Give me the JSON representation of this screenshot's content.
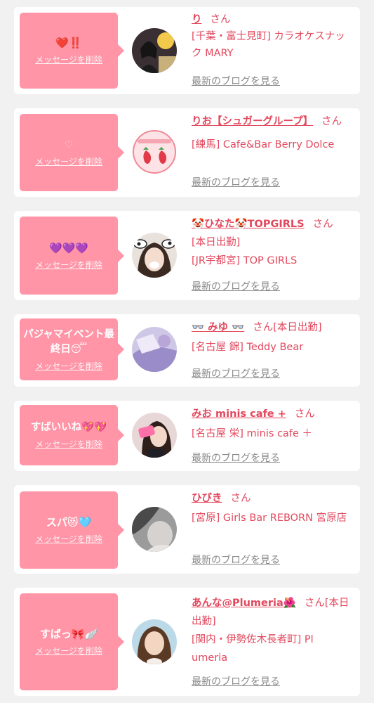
{
  "colors": {
    "background": "#f1f1f1",
    "card": "#ffffff",
    "bubble": "#ff95a7",
    "accent_text": "#e2485d",
    "muted_link": "#8a8a8a"
  },
  "delete_label": "メッセージを削除",
  "blog_label": "最新のブログを見る",
  "entries": [
    {
      "message": "❤️‼️",
      "name": "り",
      "suffix": "さん",
      "shop_lines": [
        "[千葉・富士見町] カラオケスナック MARY"
      ],
      "avatar_icon": "girl-photo-avatar"
    },
    {
      "message": "♡",
      "name": "りお【シュガーグループ】",
      "suffix": "さん",
      "shop_lines": [
        "[練馬] Cafe&Bar Berry Dolce"
      ],
      "avatar_icon": "strawberry-avatar"
    },
    {
      "message": "💜💜💜",
      "name": "🤡ひなた🤡TOPGIRLS",
      "suffix": "さん",
      "shop_lines": [
        "[本日出勤]",
        "[JR宇都宮] TOP GIRLS"
      ],
      "avatar_icon": "girl-cow-ears-avatar"
    },
    {
      "message": "パジャマイベント最終日😴",
      "name": "👓 みゆ 👓",
      "suffix": "さん[本日出勤]",
      "shop_lines": [
        "[名古屋 錦] Teddy Bear"
      ],
      "avatar_icon": "lavender-photo-avatar"
    },
    {
      "message": "すばいいね💖💖",
      "name": "みお minis cafe +",
      "suffix": "さん",
      "shop_lines": [
        "[名古屋 栄] minis cafe ＋"
      ],
      "avatar_icon": "girl-phone-avatar"
    },
    {
      "message": "スパ😻🩵",
      "name": "ひびき",
      "suffix": "さん",
      "shop_lines": [
        "[宮原] Girls Bar REBORN 宮原店"
      ],
      "avatar_icon": "gray-photo-avatar"
    },
    {
      "message": "すばっ🎀🪽",
      "name": "あんな@Plumeria🌺",
      "suffix": "さん[本日出勤]",
      "shop_lines": [
        "[関内・伊勢佐木長者町] Plumeria"
      ],
      "avatar_icon": "girl-portrait-avatar"
    }
  ]
}
